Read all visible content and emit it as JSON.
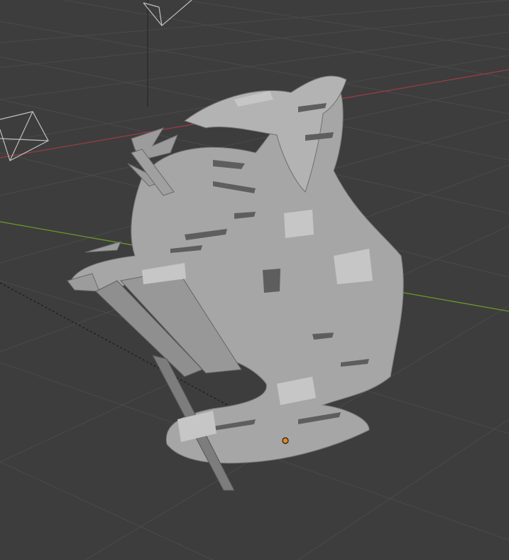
{
  "viewport": {
    "background_color": "#3d3d3d",
    "grid_color": "#4a4a4a",
    "grid_major_color": "#505050",
    "x_axis_color": "#9a3b47",
    "y_axis_color": "#6a9a2a"
  },
  "scene": {
    "mesh": {
      "shading": "solid",
      "base_color": "#a8a8a8",
      "light_color": "#c8c8c8",
      "shadow_color": "#5e5e5e",
      "description_icon": "mesh-object-icon"
    },
    "origin_marker": {
      "color": "#e08a1e",
      "icon": "object-origin-icon"
    },
    "cameras": [
      {
        "icon": "camera-icon"
      },
      {
        "icon": "camera-icon"
      }
    ]
  }
}
